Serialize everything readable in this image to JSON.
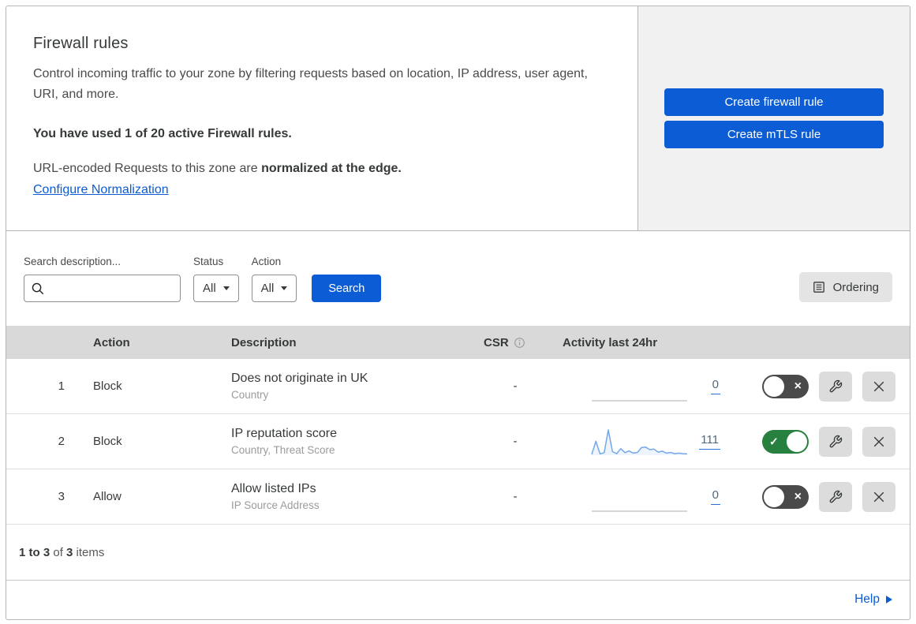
{
  "header": {
    "title": "Firewall rules",
    "description": "Control incoming traffic to your zone by filtering requests based on location, IP address, user agent, URI, and more.",
    "usage_notice": "You have used 1 of 20 active Firewall rules.",
    "normalization_text": "URL-encoded Requests to this zone are ",
    "normalization_bold": "normalized at the edge.",
    "normalization_link": "Configure Normalization",
    "create_firewall_button": "Create firewall rule",
    "create_mtls_button": "Create mTLS rule"
  },
  "filters": {
    "search_label": "Search description...",
    "search_value": "",
    "status_label": "Status",
    "status_value": "All",
    "action_label": "Action",
    "action_value": "All",
    "search_button": "Search",
    "ordering_button": "Ordering"
  },
  "table": {
    "columns": {
      "action": "Action",
      "description": "Description",
      "csr": "CSR",
      "activity": "Activity last 24hr"
    },
    "rows": [
      {
        "priority": "1",
        "action": "Block",
        "description": "Does not originate in UK",
        "criteria": "Country",
        "csr": "-",
        "activity_count": "0",
        "enabled": false,
        "spark": []
      },
      {
        "priority": "2",
        "action": "Block",
        "description": "IP reputation score",
        "criteria": "Country, Threat Score",
        "csr": "-",
        "activity_count": "111",
        "enabled": true,
        "spark": [
          3,
          55,
          5,
          10,
          100,
          14,
          6,
          26,
          10,
          17,
          8,
          11,
          30,
          32,
          22,
          24,
          12,
          16,
          8,
          11,
          6,
          8,
          6,
          5
        ]
      },
      {
        "priority": "3",
        "action": "Allow",
        "description": "Allow listed IPs",
        "criteria": "IP Source Address",
        "csr": "-",
        "activity_count": "0",
        "enabled": false,
        "spark": []
      }
    ],
    "footer": {
      "range": "1 to 3",
      "of": " of ",
      "total": "3",
      "items": " items"
    }
  },
  "help": {
    "label": "Help"
  },
  "colors": {
    "primary_blue": "#0b5cd5",
    "link_blue": "#0b5cd5",
    "toggle_on_green": "#28803f",
    "toggle_off_gray": "#4a4a4a",
    "spark_line_blue": "#74a8e8",
    "spark_flat_gray": "#bfbfbf",
    "table_header_bg": "#d9d9d9",
    "side_panel_bg": "#f1f1f2"
  }
}
